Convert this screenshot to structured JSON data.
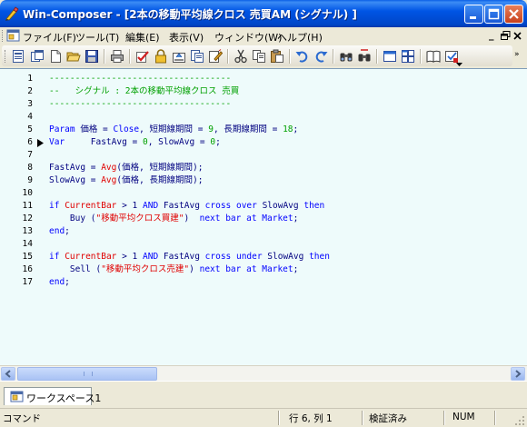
{
  "window": {
    "title": "Win-Composer - [2本の移動平均線クロス 売買AM (シグナル) ]"
  },
  "menu": {
    "items": [
      "ファイル(F)",
      "ツール(T)",
      "編集(E)",
      "表示(V)",
      "ウィンドウ(W)",
      "ヘルプ(H)"
    ]
  },
  "editor": {
    "line_numbers": [
      "1",
      "2",
      "3",
      "4",
      "5",
      "6",
      "7",
      "8",
      "9",
      "10",
      "11",
      "12",
      "13",
      "14",
      "15",
      "16",
      "17"
    ],
    "current_line": 6,
    "lines": [
      [
        {
          "t": "-----------------------------------",
          "c": "comment"
        }
      ],
      [
        {
          "t": "--   シグナル : 2本の移動平均線クロス 売買",
          "c": "comment"
        }
      ],
      [
        {
          "t": "-----------------------------------",
          "c": "comment"
        }
      ],
      [],
      [
        {
          "t": "Param",
          "c": "kw"
        },
        {
          "t": " 価格 = ",
          "c": "id"
        },
        {
          "t": "Close",
          "c": "kw"
        },
        {
          "t": ", 短期線期間 = ",
          "c": "id"
        },
        {
          "t": "9",
          "c": "num"
        },
        {
          "t": ", 長期線期間 = ",
          "c": "id"
        },
        {
          "t": "18",
          "c": "num"
        },
        {
          "t": ";",
          "c": "id"
        }
      ],
      [
        {
          "t": "Var",
          "c": "kw"
        },
        {
          "t": "     FastAvg = ",
          "c": "id"
        },
        {
          "t": "0",
          "c": "num"
        },
        {
          "t": ", SlowAvg = ",
          "c": "id"
        },
        {
          "t": "0",
          "c": "num"
        },
        {
          "t": ";",
          "c": "id"
        }
      ],
      [],
      [
        {
          "t": "FastAvg = ",
          "c": "id"
        },
        {
          "t": "Avg",
          "c": "fn"
        },
        {
          "t": "(価格, 短期線期間);",
          "c": "id"
        }
      ],
      [
        {
          "t": "SlowAvg = ",
          "c": "id"
        },
        {
          "t": "Avg",
          "c": "fn"
        },
        {
          "t": "(価格, 長期線期間);",
          "c": "id"
        }
      ],
      [],
      [
        {
          "t": "if",
          "c": "kw"
        },
        {
          "t": " ",
          "c": "id"
        },
        {
          "t": "CurrentBar",
          "c": "fn"
        },
        {
          "t": " > 1 ",
          "c": "id"
        },
        {
          "t": "AND",
          "c": "kw"
        },
        {
          "t": " FastAvg ",
          "c": "id"
        },
        {
          "t": "cross over",
          "c": "kw"
        },
        {
          "t": " SlowAvg ",
          "c": "id"
        },
        {
          "t": "then",
          "c": "kw"
        }
      ],
      [
        {
          "t": "    Buy (",
          "c": "id"
        },
        {
          "t": "\"移動平均クロス買建\"",
          "c": "str"
        },
        {
          "t": ")  ",
          "c": "id"
        },
        {
          "t": "next bar",
          "c": "kw"
        },
        {
          "t": " ",
          "c": "id"
        },
        {
          "t": "at",
          "c": "kw"
        },
        {
          "t": " ",
          "c": "id"
        },
        {
          "t": "Market",
          "c": "kw"
        },
        {
          "t": ";",
          "c": "id"
        }
      ],
      [
        {
          "t": "end",
          "c": "kw"
        },
        {
          "t": ";",
          "c": "id"
        }
      ],
      [],
      [
        {
          "t": "if",
          "c": "kw"
        },
        {
          "t": " ",
          "c": "id"
        },
        {
          "t": "CurrentBar",
          "c": "fn"
        },
        {
          "t": " > 1 ",
          "c": "id"
        },
        {
          "t": "AND",
          "c": "kw"
        },
        {
          "t": " FastAvg ",
          "c": "id"
        },
        {
          "t": "cross under",
          "c": "kw"
        },
        {
          "t": " SlowAvg ",
          "c": "id"
        },
        {
          "t": "then",
          "c": "kw"
        }
      ],
      [
        {
          "t": "    Sell (",
          "c": "id"
        },
        {
          "t": "\"移動平均クロス売建\"",
          "c": "str"
        },
        {
          "t": ") ",
          "c": "id"
        },
        {
          "t": "next bar",
          "c": "kw"
        },
        {
          "t": " ",
          "c": "id"
        },
        {
          "t": "at",
          "c": "kw"
        },
        {
          "t": " ",
          "c": "id"
        },
        {
          "t": "Market",
          "c": "kw"
        },
        {
          "t": ";",
          "c": "id"
        }
      ],
      [
        {
          "t": "end",
          "c": "kw"
        },
        {
          "t": ";",
          "c": "id"
        }
      ]
    ]
  },
  "workspace": {
    "tab_label": "ワークスペース1"
  },
  "status": {
    "mode": "コマンド",
    "position": "行 6, 列 1",
    "verify": "検証済み",
    "num": "NUM"
  },
  "colors": {
    "comment": "#00a000",
    "keyword": "#0000ff",
    "string": "#e00000",
    "editor_bg": "#eefbfb",
    "title_bar": "#0055e5"
  }
}
